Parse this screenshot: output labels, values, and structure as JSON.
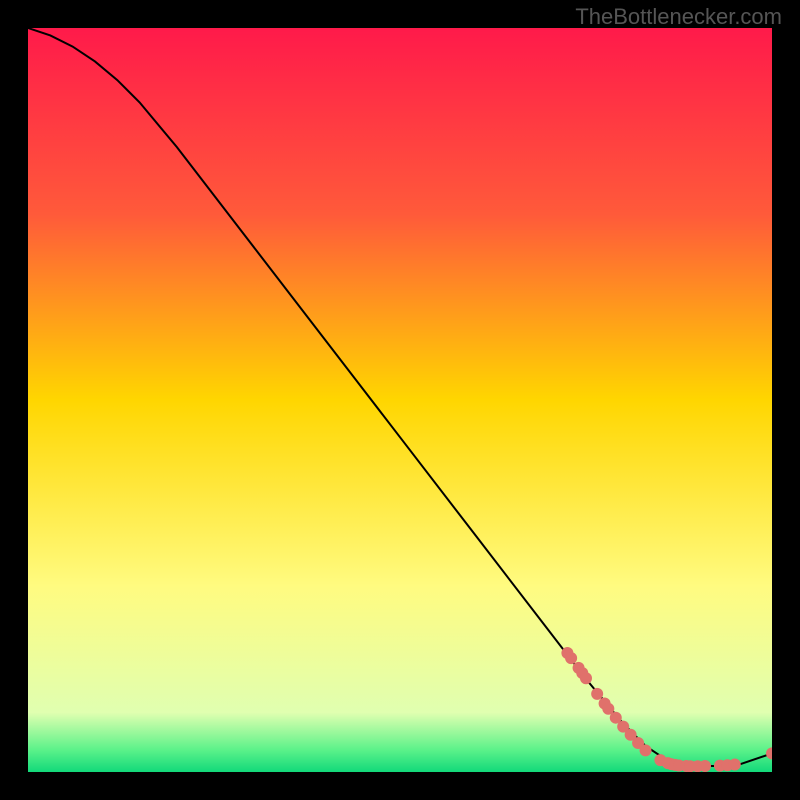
{
  "watermark": "TheBottlenecker.com",
  "chart_data": {
    "type": "line",
    "title": "",
    "xlabel": "",
    "ylabel": "",
    "xlim": [
      0,
      100
    ],
    "ylim": [
      0,
      100
    ],
    "background_gradient": {
      "stops": [
        {
          "offset": 0,
          "color": "#ff1a4a"
        },
        {
          "offset": 25,
          "color": "#ff5a3a"
        },
        {
          "offset": 50,
          "color": "#ffd600"
        },
        {
          "offset": 75,
          "color": "#fffb80"
        },
        {
          "offset": 92,
          "color": "#e0ffb0"
        },
        {
          "offset": 97,
          "color": "#5cf28a"
        },
        {
          "offset": 100,
          "color": "#12d97a"
        }
      ]
    },
    "curve": [
      {
        "x": 0,
        "y": 100
      },
      {
        "x": 3,
        "y": 99
      },
      {
        "x": 6,
        "y": 97.5
      },
      {
        "x": 9,
        "y": 95.5
      },
      {
        "x": 12,
        "y": 93
      },
      {
        "x": 15,
        "y": 90
      },
      {
        "x": 20,
        "y": 84
      },
      {
        "x": 30,
        "y": 71
      },
      {
        "x": 40,
        "y": 58
      },
      {
        "x": 50,
        "y": 45
      },
      {
        "x": 60,
        "y": 32
      },
      {
        "x": 70,
        "y": 19
      },
      {
        "x": 75,
        "y": 12.5
      },
      {
        "x": 80,
        "y": 6.5
      },
      {
        "x": 83,
        "y": 3.5
      },
      {
        "x": 86,
        "y": 1.5
      },
      {
        "x": 90,
        "y": 0.8
      },
      {
        "x": 95,
        "y": 0.8
      },
      {
        "x": 100,
        "y": 2.5
      }
    ],
    "markers": [
      {
        "x": 72.5,
        "y": 16.0
      },
      {
        "x": 73.0,
        "y": 15.3
      },
      {
        "x": 74.0,
        "y": 14.0
      },
      {
        "x": 74.5,
        "y": 13.3
      },
      {
        "x": 75.0,
        "y": 12.6
      },
      {
        "x": 76.5,
        "y": 10.5
      },
      {
        "x": 77.5,
        "y": 9.2
      },
      {
        "x": 78.0,
        "y": 8.5
      },
      {
        "x": 79.0,
        "y": 7.3
      },
      {
        "x": 80.0,
        "y": 6.1
      },
      {
        "x": 81.0,
        "y": 5.0
      },
      {
        "x": 82.0,
        "y": 3.9
      },
      {
        "x": 83.0,
        "y": 2.9
      },
      {
        "x": 85.0,
        "y": 1.6
      },
      {
        "x": 86.0,
        "y": 1.2
      },
      {
        "x": 86.5,
        "y": 1.05
      },
      {
        "x": 87.0,
        "y": 0.95
      },
      {
        "x": 87.5,
        "y": 0.88
      },
      {
        "x": 88.5,
        "y": 0.8
      },
      {
        "x": 89.0,
        "y": 0.78
      },
      {
        "x": 90.0,
        "y": 0.78
      },
      {
        "x": 91.0,
        "y": 0.8
      },
      {
        "x": 93.0,
        "y": 0.85
      },
      {
        "x": 94.0,
        "y": 0.9
      },
      {
        "x": 95.0,
        "y": 1.0
      },
      {
        "x": 100.0,
        "y": 2.5
      }
    ],
    "marker_color": "#e0716b",
    "curve_color": "#000000"
  }
}
